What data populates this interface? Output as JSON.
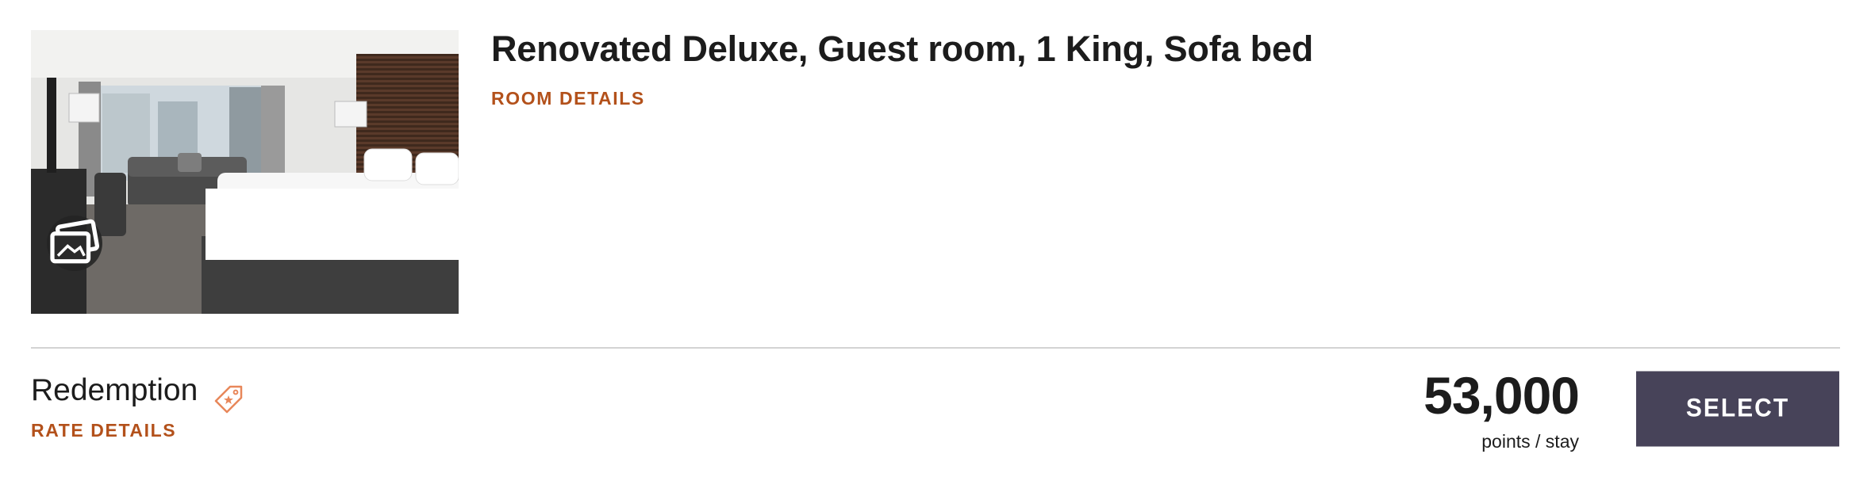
{
  "room": {
    "title": "Renovated Deluxe, Guest room, 1 King, Sofa bed",
    "details_link": "ROOM DETAILS",
    "image_icon": "photo-gallery-icon"
  },
  "rate": {
    "name": "Redemption",
    "tag_icon": "price-tag-icon",
    "details_link": "RATE DETAILS",
    "points": "53,000",
    "points_unit": "points / stay",
    "select_label": "SELECT"
  },
  "colors": {
    "accent": "#b3511b",
    "button_bg": "#474359",
    "text": "#1c1c1c",
    "divider": "#d3d3d3"
  }
}
